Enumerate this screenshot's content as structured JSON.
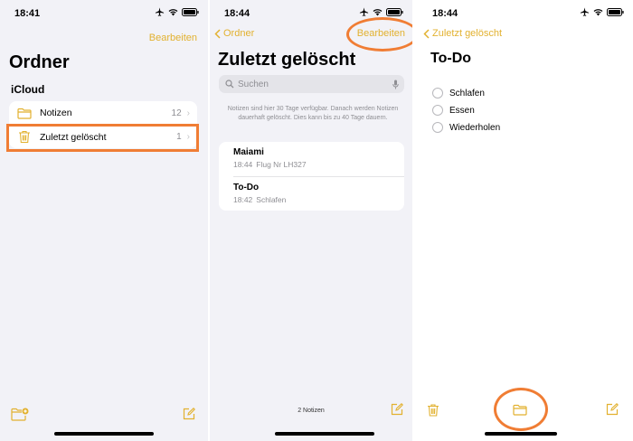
{
  "panels": [
    {
      "status_time": "18:41",
      "edit_label": "Bearbeiten",
      "title": "Ordner",
      "section": "iCloud",
      "folders": [
        {
          "name": "Notizen",
          "count": "12",
          "icon": "folder-icon"
        },
        {
          "name": "Zuletzt gelöscht",
          "count": "1",
          "icon": "trash-icon"
        }
      ]
    },
    {
      "status_time": "18:44",
      "back_label": "Ordner",
      "edit_label": "Bearbeiten",
      "title": "Zuletzt gelöscht",
      "search_placeholder": "Suchen",
      "info_text": "Notizen sind hier 30 Tage verfügbar. Danach werden Notizen dauerhaft gelöscht. Dies kann bis zu 40 Tage dauern.",
      "notes": [
        {
          "title": "Maiami",
          "time": "18:44",
          "snippet": "Flug Nr LH327"
        },
        {
          "title": "To-Do",
          "time": "18:42",
          "snippet": "Schlafen"
        }
      ],
      "note_count": "2 Notizen"
    },
    {
      "status_time": "18:44",
      "back_label": "Zuletzt gelöscht",
      "title": "To-Do",
      "checklist": [
        "Schlafen",
        "Essen",
        "Wiederholen"
      ]
    }
  ],
  "colors": {
    "accent": "#e2b12f",
    "highlight": "#f07d34",
    "grouped_background": "#f2f2f7"
  }
}
